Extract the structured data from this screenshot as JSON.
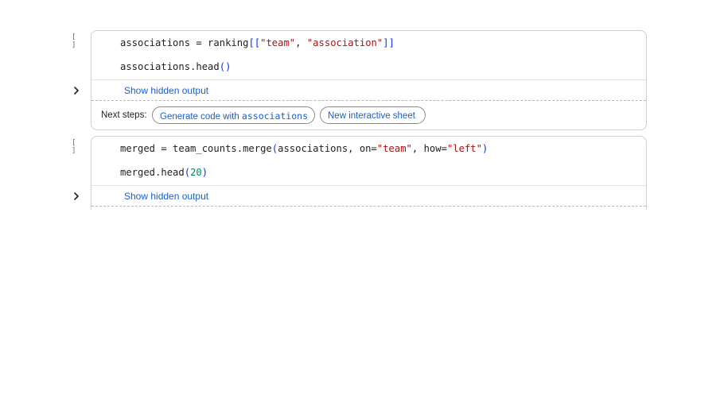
{
  "cells": [
    {
      "exec_count": "[ ]",
      "code": {
        "line1": {
          "a": "associations = ranking",
          "open": "[[",
          "s1": "\"team\"",
          "comma": ", ",
          "s2": "\"association\"",
          "close": "]]"
        },
        "line2": {
          "a": "associations.head",
          "parens": "()"
        }
      },
      "show_hidden_output": "Show hidden output",
      "next_steps": {
        "label": "Next steps:",
        "generate_prefix": "Generate code with ",
        "generate_var": "associations",
        "interactive_sheet": "New interactive sheet"
      }
    },
    {
      "exec_count": "[ ]",
      "code": {
        "line1": {
          "a": "merged = team_counts.merge",
          "open": "(",
          "b": "associations, on=",
          "s1": "\"team\"",
          "c": ", how=",
          "s2": "\"left\"",
          "close": ")"
        },
        "line2": {
          "a": "merged.head",
          "open": "(",
          "num": "20",
          "close": ")"
        }
      },
      "show_hidden_output": "Show hidden output"
    }
  ],
  "colors": {
    "string": "#a31515",
    "bracket": "#0431fa",
    "link": "#1a5fc9",
    "number": "#098658"
  },
  "icons": {
    "run_toggle": "chevron-right-icon"
  }
}
